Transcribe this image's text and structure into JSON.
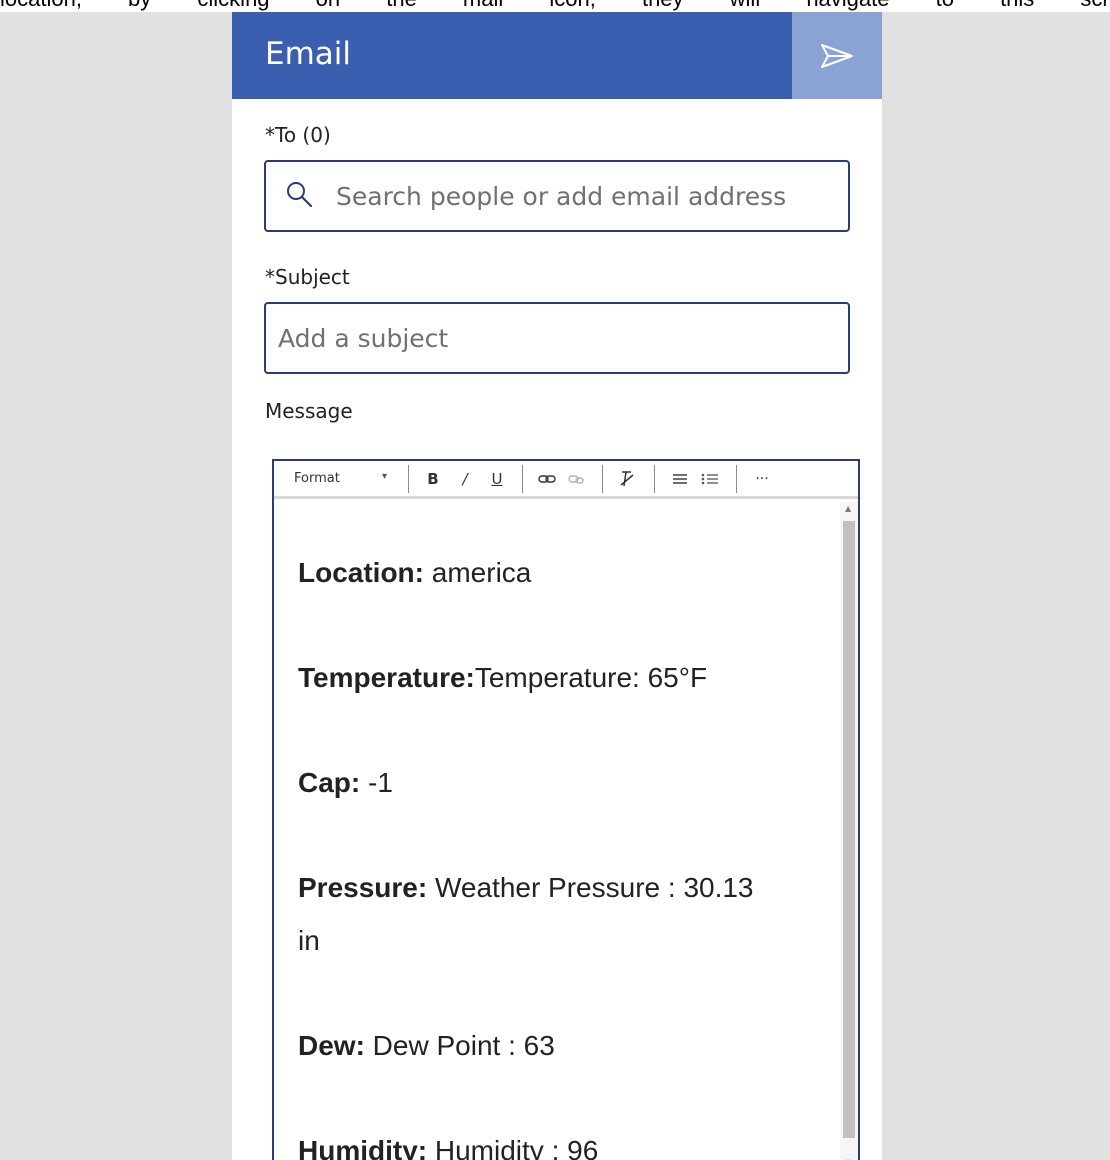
{
  "doc_strip_text": "location, by clicking on the mail icon, they will navigate to this scree",
  "header": {
    "title": "Email",
    "send_icon": "send-icon"
  },
  "to": {
    "label": "*To (0)",
    "placeholder": "Search people or add email address",
    "value": ""
  },
  "subject": {
    "label": "*Subject",
    "placeholder": "Add a subject",
    "value": ""
  },
  "message": {
    "label": "Message"
  },
  "toolbar": {
    "format_label": "Format",
    "bold": "B",
    "italic": "/",
    "underline": "U",
    "more": "···"
  },
  "body": [
    {
      "key": "Location:",
      "value": " america"
    },
    {
      "key": "Temperature:",
      "value": "Temperature: 65°F"
    },
    {
      "key": "Cap:",
      "value": " -1"
    },
    {
      "key": "Pressure:",
      "value": " Weather Pressure : 30.13 in"
    },
    {
      "key": "Dew:",
      "value": " Dew Point : 63"
    },
    {
      "key": "Humidity:",
      "value": " Humidity : 96"
    }
  ],
  "colors": {
    "header": "#3a5fb0",
    "send_button": "#8aa3d3",
    "border": "#2b3a78",
    "background": "#e1e1e1"
  }
}
